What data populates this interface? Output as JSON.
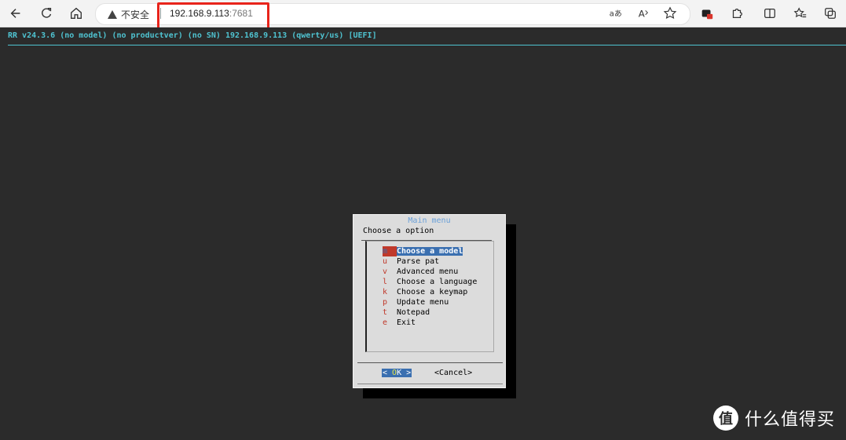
{
  "browser": {
    "address": {
      "security_label": "不安全",
      "url_host": "192.168.9.113",
      "url_port": ":7681"
    },
    "icons": [
      "back-icon",
      "refresh-icon",
      "home-icon",
      "read-aloud-icon",
      "text-size-icon",
      "favorite-star-icon",
      "extension-badge-icon",
      "extensions-icon",
      "split-screen-icon",
      "favorites-icon",
      "collections-icon"
    ]
  },
  "terminal": {
    "status_line": "RR v24.3.6 (no model) (no productver) (no SN) 192.168.9.113 (qwerty/us) [UEFI]"
  },
  "dialog": {
    "title": "Main menu",
    "prompt": "Choose a option",
    "items": [
      {
        "key": "m",
        "label": "Choose a model",
        "selected": true
      },
      {
        "key": "u",
        "label": "Parse pat"
      },
      {
        "key": "v",
        "label": "Advanced menu"
      },
      {
        "key": "l",
        "label": "Choose a language"
      },
      {
        "key": "k",
        "label": "Choose a keymap"
      },
      {
        "key": "p",
        "label": "Update menu"
      },
      {
        "key": "t",
        "label": "Notepad"
      },
      {
        "key": "e",
        "label": "Exit"
      }
    ],
    "ok_left": "< ",
    "ok_hot": "O",
    "ok_rest": "K",
    "ok_right": " >",
    "cancel_label": "<Cancel>"
  },
  "watermark": {
    "logo_char": "值",
    "text": "什么值得买"
  }
}
